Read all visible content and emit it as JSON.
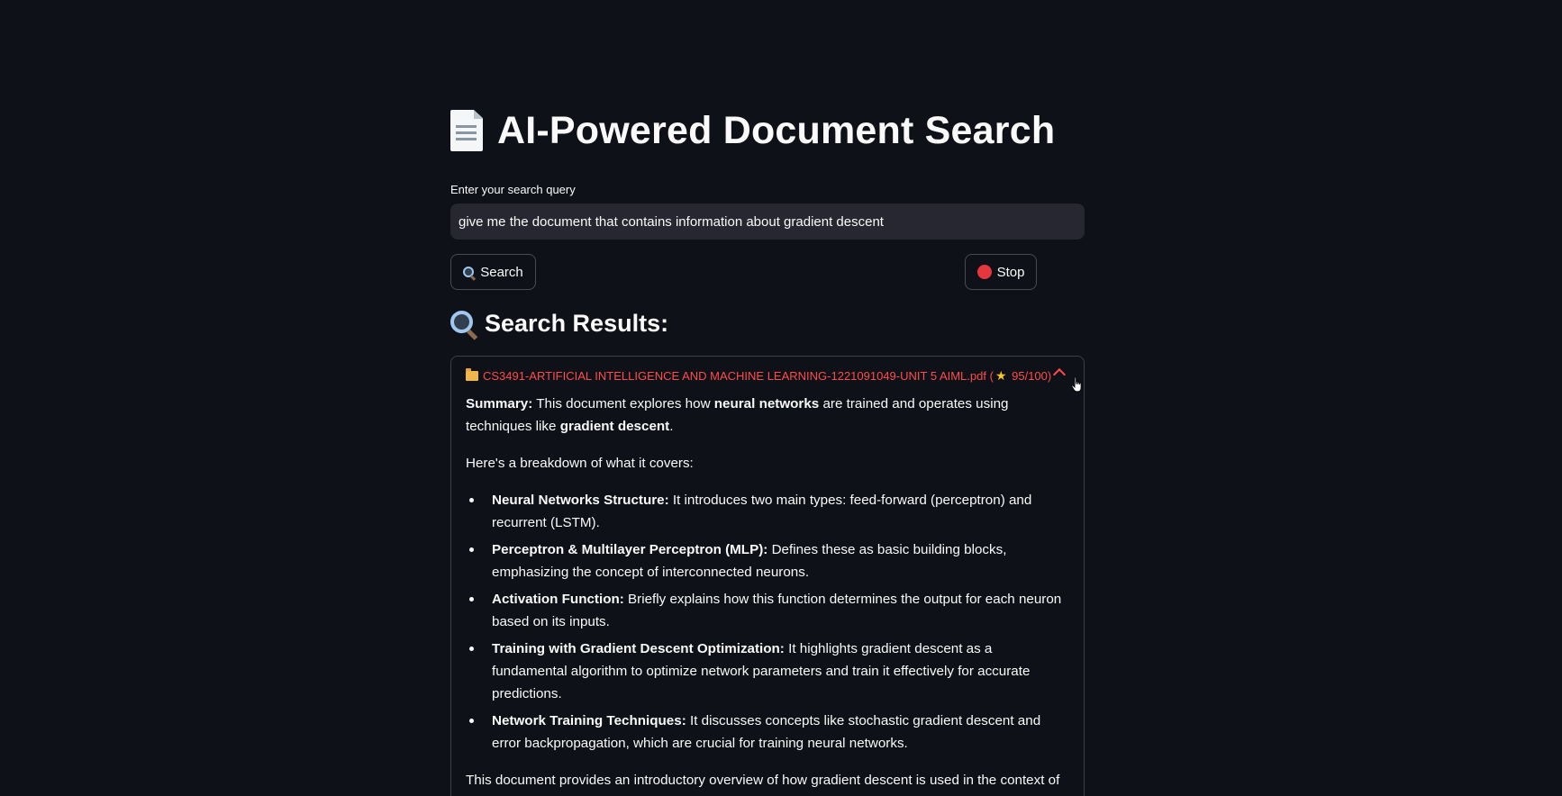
{
  "header": {
    "title": "AI-Powered Document Search",
    "title_icon": "page-facing-up-icon"
  },
  "search": {
    "label": "Enter your search query",
    "value": "give me the document that contains information about gradient descent"
  },
  "buttons": {
    "search_label": "Search",
    "search_icon": "magnifying-glass-icon",
    "stop_label": "Stop",
    "stop_icon": "red-circle-icon"
  },
  "results": {
    "heading": "Search Results:",
    "heading_icon": "magnifying-glass-icon",
    "items": [
      {
        "filename": "CS3491-ARTIFICIAL INTELLIGENCE AND MACHINE LEARNING-1221091049-UNIT 5 AIML.pdf",
        "score_prefix": "(",
        "score": "95/100)",
        "expanded": true,
        "summary": {
          "label": "Summary:",
          "t1": " This document explores how ",
          "b1": "neural networks",
          "t2": " are trained and operates using techniques like ",
          "b2": "gradient descent",
          "t3": "."
        },
        "breakdown_intro": "Here's a breakdown of what it covers:",
        "bullets": [
          {
            "title": "Neural Networks Structure:",
            "text": " It introduces two main types: feed-forward (perceptron) and recurrent (LSTM)."
          },
          {
            "title": "Perceptron & Multilayer Perceptron (MLP):",
            "text": " Defines these as basic building blocks, emphasizing the concept of interconnected neurons."
          },
          {
            "title": "Activation Function:",
            "text": " Briefly explains how this function determines the output for each neuron based on its inputs."
          },
          {
            "title": "Training with Gradient Descent Optimization:",
            "text": " It highlights gradient descent as a fundamental algorithm to optimize network parameters and train it effectively for accurate predictions."
          },
          {
            "title": "Network Training Techniques:",
            "text": " It discusses concepts like stochastic gradient descent and error backpropagation, which are crucial for training neural networks."
          }
        ],
        "conclusion": "This document provides an introductory overview of how gradient descent is used in the context of neural networks."
      }
    ]
  },
  "colors": {
    "background": "#0e1117",
    "input_background": "#262730",
    "accent": "#ff4b4b",
    "text": "#fafafa"
  }
}
